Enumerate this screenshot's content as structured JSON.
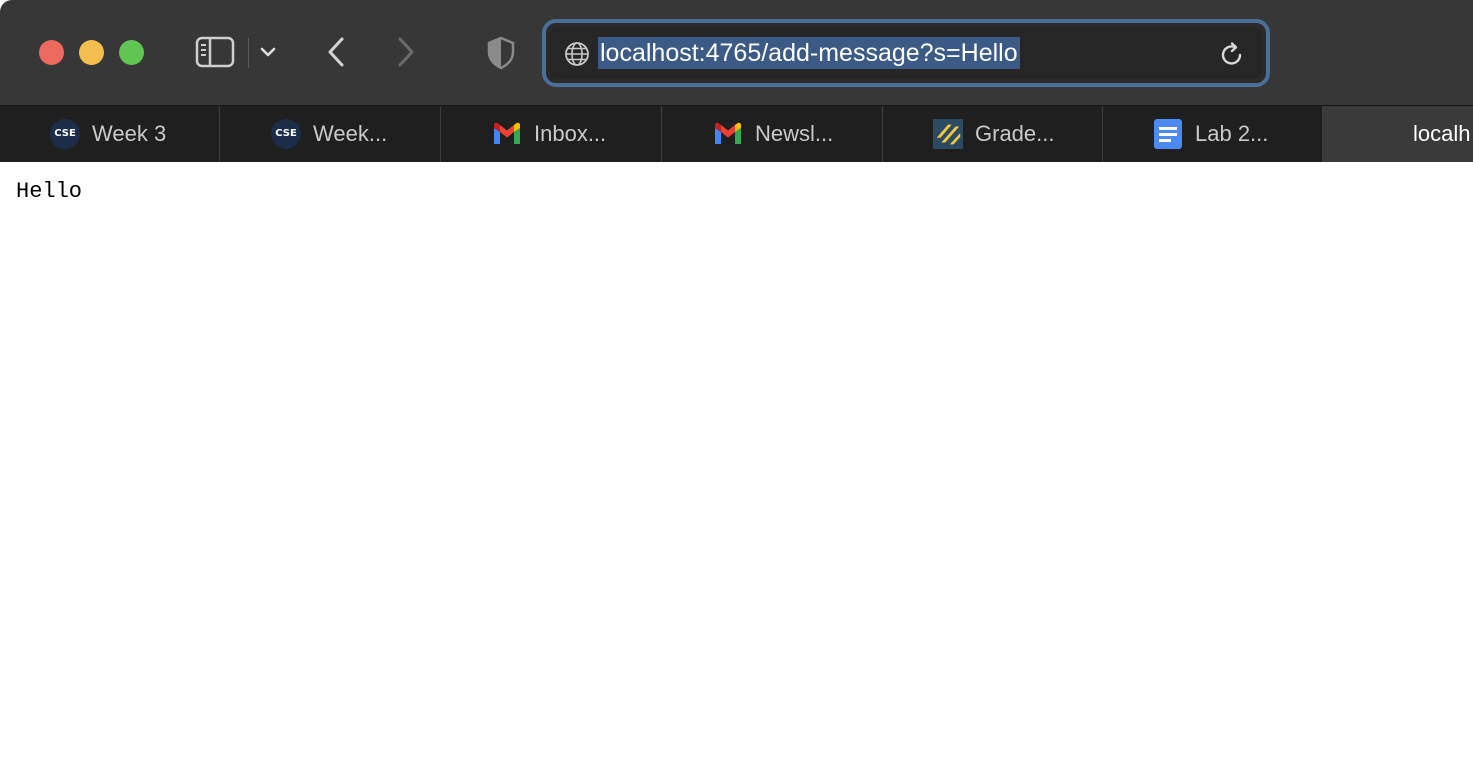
{
  "address_bar": {
    "url": "localhost:4765/add-message?s=Hello"
  },
  "tabs": [
    {
      "label": "Week 3",
      "favicon": "cse-logo-icon",
      "favicon_text": "CSE"
    },
    {
      "label": "Week...",
      "favicon": "cse-logo-icon",
      "favicon_text": "CSE"
    },
    {
      "label": "Inbox...",
      "favicon": "gmail-icon"
    },
    {
      "label": "Newsl...",
      "favicon": "gmail-icon"
    },
    {
      "label": "Grade...",
      "favicon": "gradescope-icon"
    },
    {
      "label": "Lab 2...",
      "favicon": "google-docs-icon"
    },
    {
      "label": "localh",
      "favicon": "none",
      "active": true
    }
  ],
  "page": {
    "body_text": "Hello"
  },
  "colors": {
    "close": "#ed6a5e",
    "minimize": "#f5bf4f",
    "maximize": "#61c554",
    "address_focus": "#4a6f98",
    "url_selection": "#3b5a86"
  }
}
